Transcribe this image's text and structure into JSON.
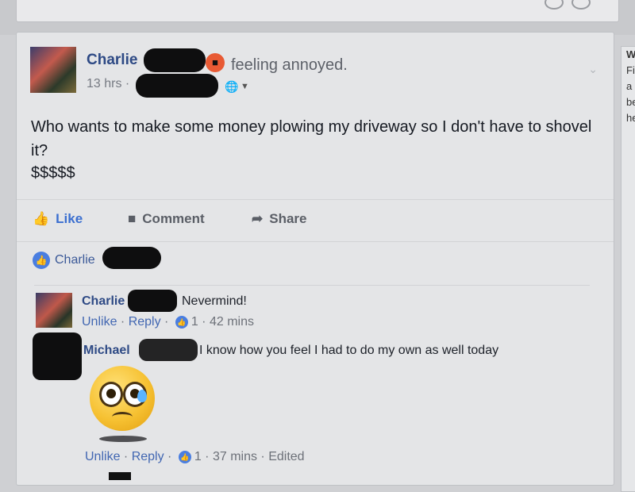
{
  "post": {
    "author": "Charlie",
    "feeling": "feeling annoyed.",
    "time": "13 hrs ·",
    "text": "Who wants to make some money plowing my driveway so I don't have to shovel it?",
    "money": "$$$$$",
    "actions": {
      "like": "Like",
      "comment": "Comment",
      "share": "Share"
    },
    "likes_by": "Charlie"
  },
  "comments": [
    {
      "author": "Charlie",
      "text": "Nevermind!",
      "unlike": "Unlike",
      "reply": "Reply",
      "likes": "1",
      "time": "· 42 mins"
    },
    {
      "author": "Michael",
      "text": "I know how you feel I had to do my own as well today",
      "unlike": "Unlike",
      "reply": "Reply",
      "likes": "1",
      "time": "· 37 mins",
      "edited": "· Edited"
    }
  ],
  "side_panel": {
    "lines": [
      "W",
      "Fi",
      "a",
      "be",
      "he"
    ]
  },
  "icons": {
    "feeling": "angry-face-icon",
    "privacy": "globe-icon",
    "like": "thumbs-up-icon",
    "comment": "speech-bubble-icon",
    "share": "share-arrow-icon",
    "sticker": "sad-crying-emoji-icon"
  },
  "colors": {
    "link": "#2e4a85",
    "like_blue": "#3b6fd0",
    "angry": "#e85a34"
  }
}
